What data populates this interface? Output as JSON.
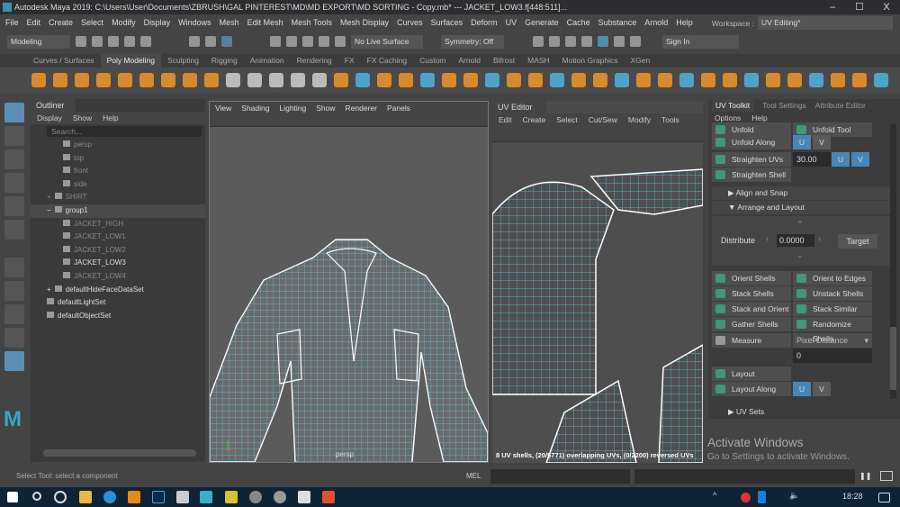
{
  "title": "Autodesk Maya 2019: C:\\Users\\User\\Documents\\ZBRUSH\\GAL PINTEREST\\MD\\MD EXPORT\\MD SORTING - Copy.mb*  ---  JACKET_LOW3.f[448:511]...",
  "window_buttons": {
    "minimize": "–",
    "maximize": "☐",
    "close": "X"
  },
  "menu": [
    "File",
    "Edit",
    "Create",
    "Select",
    "Modify",
    "Display",
    "Windows",
    "Mesh",
    "Edit Mesh",
    "Mesh Tools",
    "Mesh Display",
    "Curves",
    "Surfaces",
    "Deform",
    "UV",
    "Generate",
    "Cache",
    "Substance",
    "Arnold",
    "Help"
  ],
  "workspace": {
    "label": "Workspace :",
    "value": "UV Editing*"
  },
  "toolbar": {
    "mode": "Modeling",
    "live_surface": "No Live Surface",
    "symmetry": "Symmetry: Off",
    "sign_in": "Sign In"
  },
  "shelf_tabs": [
    "Curves / Surfaces",
    "Poly Modeling",
    "Sculpting",
    "Rigging",
    "Animation",
    "Rendering",
    "FX",
    "FX Caching",
    "Custom",
    "Arnold",
    "Bifrost",
    "MASH",
    "Motion Graphics",
    "XGen"
  ],
  "shelf_active": "Poly Modeling",
  "outliner": {
    "title": "Outliner",
    "menu": [
      "Display",
      "Show",
      "Help"
    ],
    "search_placeholder": "Search...",
    "items": [
      {
        "label": "persp",
        "dim": true,
        "indent": 2
      },
      {
        "label": "top",
        "dim": true,
        "indent": 2
      },
      {
        "label": "front",
        "dim": true,
        "indent": 2
      },
      {
        "label": "side",
        "dim": true,
        "indent": 2
      },
      {
        "label": "SHIRT",
        "dim": true,
        "indent": 1,
        "expand": "+"
      },
      {
        "label": "group1",
        "dim": false,
        "indent": 1,
        "expand": "−",
        "selected": true
      },
      {
        "label": "JACKET_HIGH",
        "dim": true,
        "indent": 2
      },
      {
        "label": "JACKET_LOW1",
        "dim": true,
        "indent": 2
      },
      {
        "label": "JACKET_LOW2",
        "dim": true,
        "indent": 2
      },
      {
        "label": "JACKET_LOW3",
        "dim": false,
        "indent": 2
      },
      {
        "label": "JACKET_LOW4",
        "dim": true,
        "indent": 2
      },
      {
        "label": "defaultHideFaceDataSet",
        "dim": false,
        "indent": 1,
        "expand": "+"
      },
      {
        "label": "defaultLightSet",
        "dim": false,
        "indent": 1
      },
      {
        "label": "defaultObjectSet",
        "dim": false,
        "indent": 1
      }
    ]
  },
  "viewport": {
    "menu": [
      "View",
      "Shading",
      "Lighting",
      "Show",
      "Renderer",
      "Panels"
    ],
    "camera": "persp"
  },
  "uv_editor": {
    "title": "UV Editor",
    "menu": [
      "Edit",
      "Create",
      "Select",
      "Cut/Sew",
      "Modify",
      "Tools"
    ],
    "status": "8 UV shells, (20/5771) overlapping UVs, (0/2200) reversed UVs"
  },
  "uv_toolkit": {
    "tabs": [
      "UV Toolkit",
      "Tool Settings",
      "Attribute Editor"
    ],
    "menu": [
      "Options",
      "Help"
    ],
    "unfold": "Unfold",
    "unfold_tool": "Unfold Tool",
    "unfold_along": "Unfold Along",
    "straighten_uvs": "Straighten UVs",
    "straighten_value": "30.00",
    "straighten_shell": "Straighten Shell",
    "u": "U",
    "v": "V",
    "align_snap": "Align and Snap",
    "arrange_layout": "Arrange and Layout",
    "distribute": "Distribute",
    "distribute_value": "0.0000",
    "target": "Target",
    "buttons": [
      "Orient Shells",
      "Orient to Edges",
      "Stack Shells",
      "Unstack Shells",
      "Stack and Orient",
      "Stack Similar",
      "Gather Shells",
      "Randomize Shells"
    ],
    "measure": "Measure",
    "measure_mode": "Pixel Distance",
    "measure_value": "0",
    "layout": "Layout",
    "layout_along": "Layout Along",
    "uv_sets": "UV Sets"
  },
  "watermark": {
    "line1": "Activate Windows",
    "line2": "Go to Settings to activate Windows."
  },
  "command_line": {
    "lang": "MEL"
  },
  "help_line": "Select Tool: select a component",
  "taskbar": {
    "time": "18:28"
  },
  "colors": {
    "accent": "#4a86b5",
    "wireframe": "#5fc8e8",
    "shelf_orange": "#d88a2c",
    "toolkit_green": "#3d9977"
  }
}
